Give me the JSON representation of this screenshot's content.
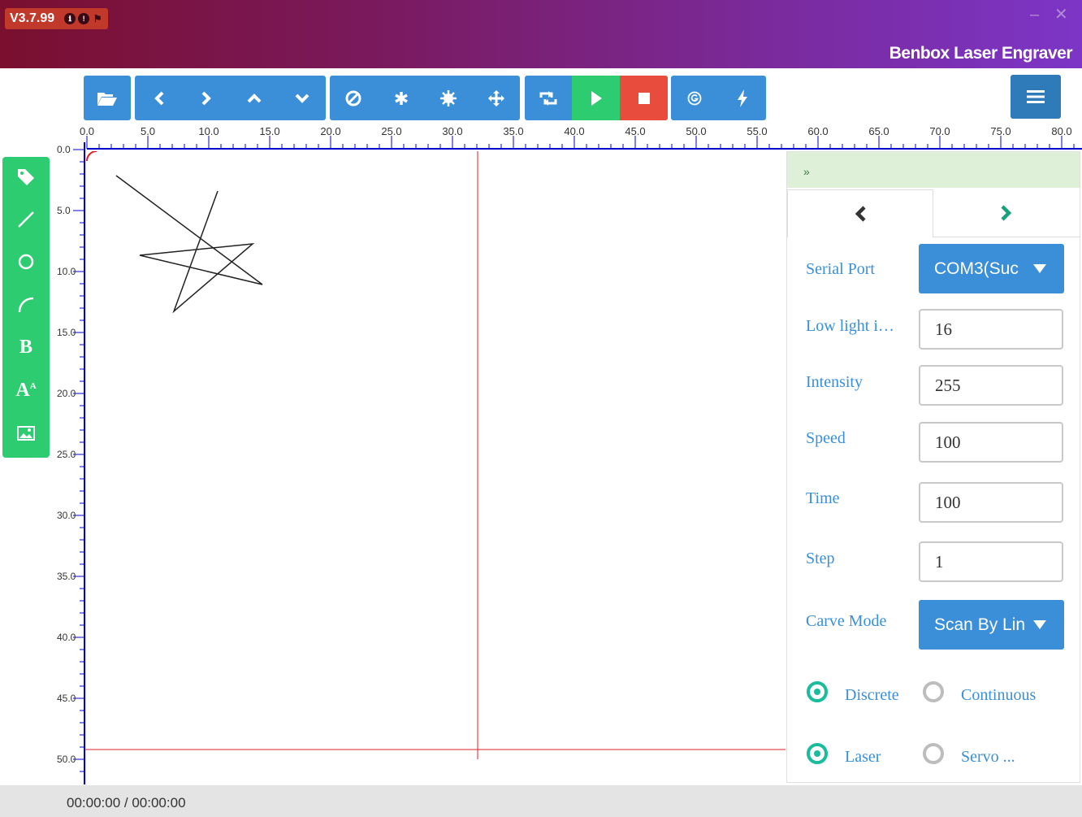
{
  "app": {
    "version": "V3.7.99",
    "title": "Benbox Laser Engraver",
    "minimize": "–",
    "close": "✕"
  },
  "ruler": {
    "x_labels": [
      "0.0",
      "5.0",
      "10.0",
      "15.0",
      "20.0",
      "25.0",
      "30.0",
      "35.0",
      "40.0",
      "45.0",
      "50.0",
      "55.0",
      "60.0",
      "65.0",
      "70.0",
      "75.0",
      "80.0"
    ],
    "y_labels": [
      "0.0",
      "5.0",
      "10.0",
      "15.0",
      "20.0",
      "25.0",
      "30.0",
      "35.0",
      "40.0",
      "45.0",
      "50.0"
    ]
  },
  "toolbar": {
    "icons": [
      "folder-open-icon",
      "chevron-left-icon",
      "chevron-right-icon",
      "chevron-up-icon",
      "chevron-down-icon",
      "ban-icon",
      "asterisk-icon",
      "sun-icon",
      "move-icon",
      "retweet-icon",
      "play-icon",
      "stop-icon",
      "g-code-icon",
      "bolt-icon",
      "menu-icon"
    ]
  },
  "sidebar": {
    "tools": [
      "tag-icon",
      "line-icon",
      "circle-icon",
      "arc-icon",
      "bold-text-icon",
      "font-size-icon",
      "image-icon"
    ],
    "bold_label": "B",
    "font_label": "A"
  },
  "panel": {
    "collapse_label": "»",
    "fields": [
      {
        "label": "Serial Port",
        "type": "select",
        "value": "COM3(Suc"
      },
      {
        "label": "Low light i…",
        "type": "input",
        "value": "16"
      },
      {
        "label": "Intensity",
        "type": "input",
        "value": "255"
      },
      {
        "label": "Speed",
        "type": "input",
        "value": "100"
      },
      {
        "label": "Time",
        "type": "input",
        "value": "100"
      },
      {
        "label": "Step",
        "type": "input",
        "value": "1"
      },
      {
        "label": "Carve Mode",
        "type": "select",
        "value": "Scan By Lin"
      }
    ],
    "radio_group_1": {
      "options": [
        "Discrete",
        "Continuous"
      ],
      "selected": "Discrete"
    },
    "radio_group_2": {
      "options": [
        "Laser",
        "Servo ..."
      ],
      "selected": "Laser"
    }
  },
  "status": {
    "time": "00:00:00 / 00:00:00"
  },
  "colors": {
    "toolbar_blue": "#3a8fd8",
    "play_green": "#2ecc71",
    "stop_red": "#e74c3c",
    "sidebar_green": "#2ecc71",
    "ruler_blue": "#0000cc",
    "crosshair_red": "#e02020",
    "radio_teal": "#1abc9c"
  }
}
